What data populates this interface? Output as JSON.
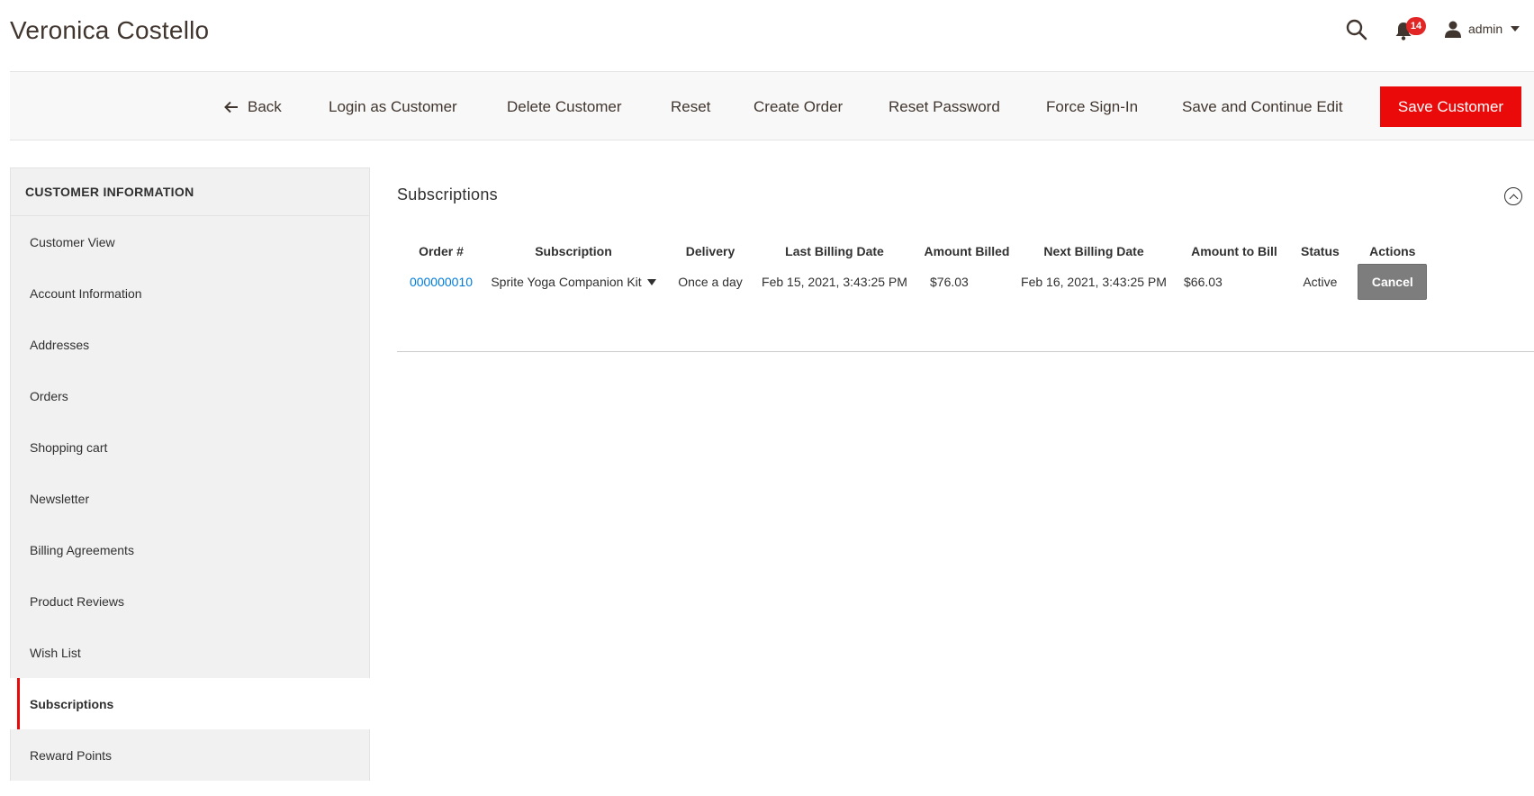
{
  "header": {
    "title": "Veronica Costello",
    "notifications_count": "14",
    "user_name": "admin"
  },
  "toolbar": {
    "back_label": "Back",
    "login_as_customer_label": "Login as Customer",
    "delete_customer_label": "Delete Customer",
    "reset_label": "Reset",
    "create_order_label": "Create Order",
    "reset_password_label": "Reset Password",
    "force_sign_in_label": "Force Sign-In",
    "save_continue_label": "Save and Continue Edit",
    "save_customer_label": "Save Customer"
  },
  "sidebar": {
    "title": "CUSTOMER INFORMATION",
    "items": [
      {
        "label": "Customer View"
      },
      {
        "label": "Account Information"
      },
      {
        "label": "Addresses"
      },
      {
        "label": "Orders"
      },
      {
        "label": "Shopping cart"
      },
      {
        "label": "Newsletter"
      },
      {
        "label": "Billing Agreements"
      },
      {
        "label": "Product Reviews"
      },
      {
        "label": "Wish List"
      },
      {
        "label": "Subscriptions"
      },
      {
        "label": "Reward Points"
      }
    ],
    "active_item": "Subscriptions"
  },
  "main": {
    "section_title": "Subscriptions",
    "table": {
      "headers": [
        "Order #",
        "Subscription",
        "Delivery",
        "Last Billing Date",
        "Amount Billed",
        "Next Billing Date",
        "Amount to Bill",
        "Status",
        "Actions"
      ],
      "rows": [
        {
          "order": "000000010",
          "subscription": "Sprite Yoga Companion Kit",
          "delivery": "Once a day",
          "last_billing_date": "Feb 15, 2021, 3:43:25 PM",
          "amount_billed": "$76.03",
          "next_billing_date": "Feb 16, 2021, 3:43:25 PM",
          "amount_to_bill": "$66.03",
          "status": "Active",
          "action_label": "Cancel"
        }
      ]
    }
  },
  "colors": {
    "accent": "#eb0a0a",
    "link": "#007bdb",
    "badge": "#e22626",
    "sidebar_bg": "#f1f1f1",
    "toolbar_bg": "#f8f8f8",
    "cancel_button": "#7d7d7d"
  },
  "icons": {
    "search": "search-icon",
    "notifications": "bell-icon",
    "user": "user-icon",
    "back": "arrow-left-icon",
    "collapse": "chevron-up-icon",
    "dropdown": "caret-down-icon"
  }
}
